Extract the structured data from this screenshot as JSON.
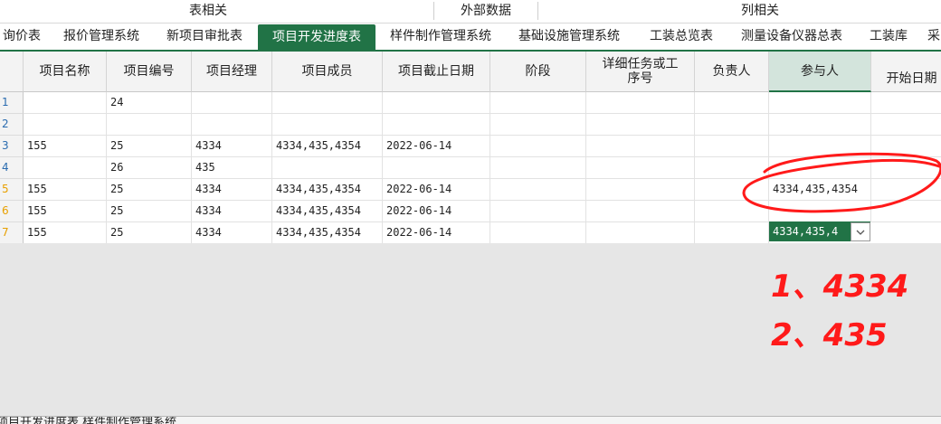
{
  "groups": {
    "table_related": "表相关",
    "external_data": "外部数据",
    "column_related": "列相关"
  },
  "tabs": [
    {
      "label": "询价表",
      "active": false
    },
    {
      "label": "报价管理系统",
      "active": false
    },
    {
      "label": "新项目审批表",
      "active": false
    },
    {
      "label": "项目开发进度表",
      "active": true
    },
    {
      "label": "样件制作管理系统",
      "active": false
    },
    {
      "label": "基础设施管理系统",
      "active": false
    },
    {
      "label": "工装总览表",
      "active": false
    },
    {
      "label": "测量设备仪器总表",
      "active": false
    },
    {
      "label": "工装库",
      "active": false
    },
    {
      "label": "采",
      "active": false
    }
  ],
  "table": {
    "headers": [
      "项目名称",
      "项目编号",
      "项目经理",
      "项目成员",
      "项目截止日期",
      "阶段",
      "详细任务或工序号",
      "负责人",
      "参与人",
      "开始日期"
    ],
    "row_numbers": [
      "1",
      "2",
      "3",
      "4",
      "5",
      "6",
      "7"
    ],
    "rows": [
      [
        "",
        "24",
        "",
        "",
        "",
        "",
        "",
        "",
        "",
        ""
      ],
      [
        "",
        "",
        "",
        "",
        "",
        "",
        "",
        "",
        "",
        ""
      ],
      [
        "155",
        "25",
        "4334",
        "4334,435,4354",
        "2022-06-14",
        "",
        "",
        "",
        "",
        ""
      ],
      [
        "",
        "26",
        "435",
        "",
        "",
        "",
        "",
        "",
        "",
        ""
      ],
      [
        "155",
        "25",
        "4334",
        "4334,435,4354",
        "2022-06-14",
        "",
        "",
        "",
        "4334,435,4354",
        ""
      ],
      [
        "155",
        "25",
        "4334",
        "4334,435,4354",
        "2022-06-14",
        "",
        "",
        "",
        "",
        ""
      ],
      [
        "155",
        "25",
        "4334",
        "4334,435,4354",
        "2022-06-14",
        "",
        "",
        "",
        "",
        ""
      ]
    ],
    "editing_value": "4334,435,4"
  },
  "status_text": "项目开发进度表,样件制作管理系统",
  "annotation": {
    "line1": "1、4334",
    "line2": "2、435",
    "color": "#ff1a1a"
  },
  "colors": {
    "accent": "#217346"
  }
}
